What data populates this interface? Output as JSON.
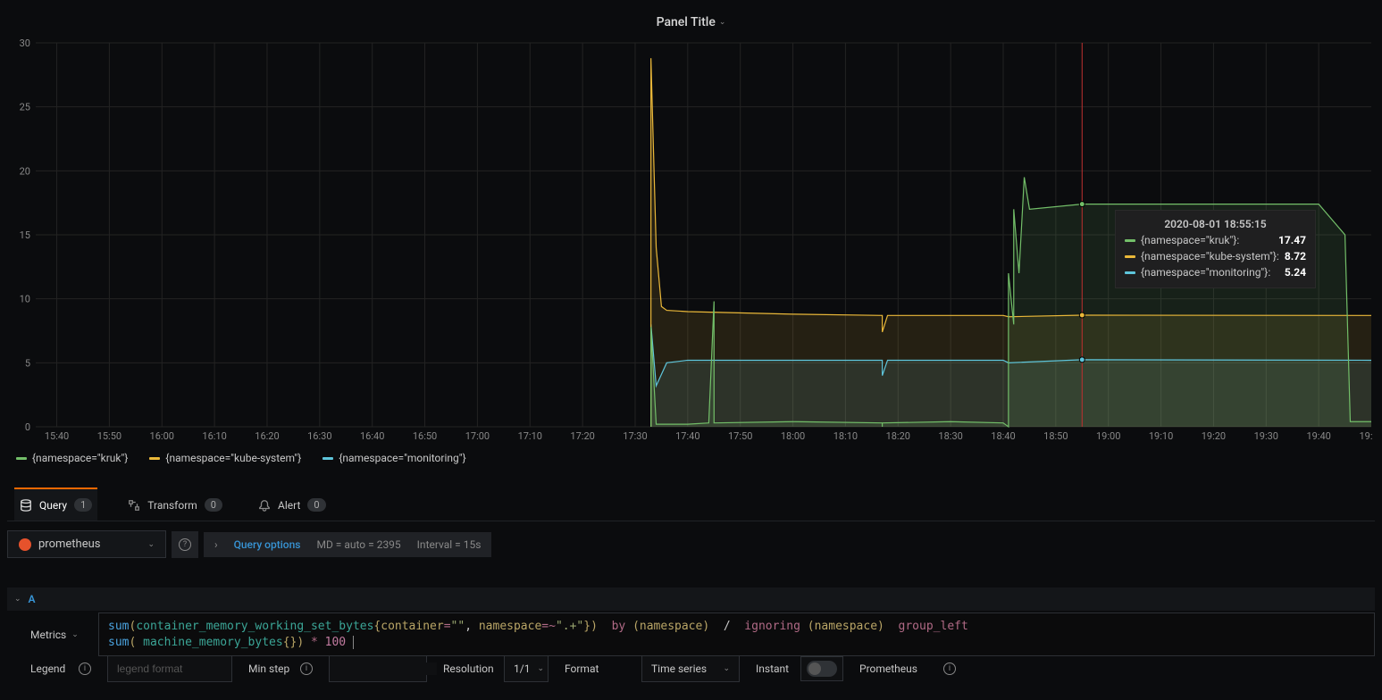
{
  "panel": {
    "title": "Panel Title"
  },
  "chart_data": {
    "type": "line",
    "yticks": [
      0,
      5,
      10,
      15,
      20,
      25,
      30
    ],
    "xticks": [
      "15:40",
      "15:50",
      "16:00",
      "16:10",
      "16:20",
      "16:30",
      "16:40",
      "16:50",
      "17:00",
      "17:10",
      "17:20",
      "17:30",
      "17:40",
      "17:50",
      "18:00",
      "18:10",
      "18:20",
      "18:30",
      "18:40",
      "18:50",
      "19:00",
      "19:10",
      "19:20",
      "19:30",
      "19:40",
      "19:"
    ],
    "xlim": [
      "15:36",
      "19:50"
    ],
    "ylim": [
      0,
      30
    ],
    "series": [
      {
        "name": "{namespace=\"kruk\"}",
        "color": "#73BF69",
        "points": [
          [
            "17:33",
            0
          ],
          [
            "17:33",
            7.8
          ],
          [
            "17:34",
            0.2
          ],
          [
            "17:40",
            0.2
          ],
          [
            "17:44",
            0.3
          ],
          [
            "17:45",
            9.8
          ],
          [
            "17:45",
            0.3
          ],
          [
            "18:00",
            0.4
          ],
          [
            "18:17",
            0.3
          ],
          [
            "18:17",
            0.0
          ],
          [
            "18:17",
            0.3
          ],
          [
            "18:30",
            0.4
          ],
          [
            "18:40",
            0.3
          ],
          [
            "18:41",
            0.0
          ],
          [
            "18:41",
            12
          ],
          [
            "18:42",
            8
          ],
          [
            "18:42",
            17
          ],
          [
            "18:43",
            12
          ],
          [
            "18:44",
            19.5
          ],
          [
            "18:45",
            17
          ],
          [
            "18:55",
            17.4
          ],
          [
            "19:10",
            17.4
          ],
          [
            "19:40",
            17.4
          ],
          [
            "19:45",
            15
          ],
          [
            "19:46",
            0.4
          ],
          [
            "19:50",
            0.4
          ]
        ]
      },
      {
        "name": "{namespace=\"kube-system\"}",
        "color": "#EAB839",
        "points": [
          [
            "17:33",
            0
          ],
          [
            "17:33",
            28.8
          ],
          [
            "17:34",
            14
          ],
          [
            "17:35",
            9.4
          ],
          [
            "17:36",
            9.1
          ],
          [
            "17:40",
            9.0
          ],
          [
            "18:00",
            8.8
          ],
          [
            "18:17",
            8.7
          ],
          [
            "18:17",
            7.4
          ],
          [
            "18:18",
            8.7
          ],
          [
            "18:40",
            8.7
          ],
          [
            "18:41",
            8.6
          ],
          [
            "18:55",
            8.72
          ],
          [
            "19:50",
            8.7
          ]
        ]
      },
      {
        "name": "{namespace=\"monitoring\"}",
        "color": "#5EC5DB",
        "points": [
          [
            "17:33",
            0
          ],
          [
            "17:33",
            8.0
          ],
          [
            "17:34",
            3.2
          ],
          [
            "17:36",
            5.0
          ],
          [
            "17:40",
            5.2
          ],
          [
            "18:00",
            5.2
          ],
          [
            "18:17",
            5.2
          ],
          [
            "18:17",
            4.0
          ],
          [
            "18:18",
            5.2
          ],
          [
            "18:40",
            5.2
          ],
          [
            "18:41",
            5.0
          ],
          [
            "18:55",
            5.24
          ],
          [
            "19:50",
            5.2
          ]
        ]
      }
    ],
    "hover_time": "18:55"
  },
  "tooltip": {
    "time": "2020-08-01 18:55:15",
    "rows": [
      {
        "label": "{namespace=\"kruk\"}:",
        "value": "17.47",
        "color": "#73BF69"
      },
      {
        "label": "{namespace=\"kube-system\"}:",
        "value": "8.72",
        "color": "#EAB839"
      },
      {
        "label": "{namespace=\"monitoring\"}:",
        "value": "5.24",
        "color": "#5EC5DB"
      }
    ]
  },
  "legend": {
    "items": [
      {
        "label": "{namespace=\"kruk\"}",
        "color": "#73BF69"
      },
      {
        "label": "{namespace=\"kube-system\"}",
        "color": "#EAB839"
      },
      {
        "label": "{namespace=\"monitoring\"}",
        "color": "#5EC5DB"
      }
    ]
  },
  "tabs": {
    "query": {
      "label": "Query",
      "badge": "1"
    },
    "transform": {
      "label": "Transform",
      "badge": "0"
    },
    "alert": {
      "label": "Alert",
      "badge": "0"
    }
  },
  "datasource": {
    "name": "prometheus"
  },
  "query_options": {
    "label": "Query options",
    "md": "MD = auto = 2395",
    "interval": "Interval = 15s"
  },
  "query_a": {
    "label": "A"
  },
  "metrics_label": "Metrics",
  "promql": {
    "line1_parts": [
      "sum",
      "(",
      "container_memory_working_set_bytes",
      "{",
      "container",
      "=",
      "\"\"",
      ", ",
      "namespace",
      "=~",
      "\".+\"",
      "}",
      ") ",
      " by ",
      "(",
      "namespace",
      ")",
      "  / ",
      " ignoring ",
      "(",
      "namespace",
      ") ",
      " group_left"
    ],
    "line2_parts": [
      "sum",
      "( ",
      "machine_memory_bytes",
      "{}",
      ") ",
      "*",
      " 100 "
    ]
  },
  "bottom": {
    "legend_label": "Legend",
    "legend_placeholder": "legend format",
    "minstep_label": "Min step",
    "resolution_label": "Resolution",
    "resolution_value": "1/1",
    "format_label": "Format",
    "format_value": "Time series",
    "instant_label": "Instant",
    "prometheus_label": "Prometheus"
  }
}
